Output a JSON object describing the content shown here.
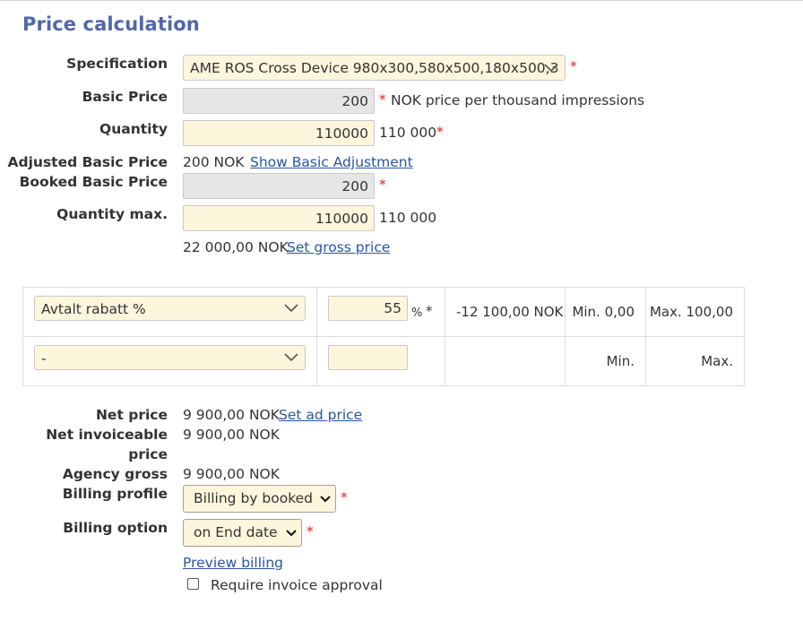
{
  "page": {
    "title": "Price calculation"
  },
  "fields": {
    "specification": {
      "label": "Specification",
      "value": "AME ROS Cross Device 980x300,580x500,180x500,3",
      "required": "*"
    },
    "basic_price": {
      "label": "Basic Price",
      "value": "200",
      "required": "*",
      "unit_note": "NOK price per thousand impressions"
    },
    "quantity": {
      "label": "Quantity",
      "value": "110000",
      "formatted": "110 000",
      "required": "*"
    },
    "adjusted_basic_price": {
      "label": "Adjusted Basic Price",
      "value": "200 NOK",
      "link": "Show Basic Adjustment"
    },
    "booked_basic_price": {
      "label": "Booked Basic Price",
      "value": "200",
      "required": "*"
    },
    "quantity_max": {
      "label": "Quantity max.",
      "value": "110000",
      "formatted": "110 000"
    },
    "gross": {
      "value": "22 000,00 NOK",
      "link": "Set gross price"
    }
  },
  "discounts": [
    {
      "type": "Avtalt rabatt %",
      "value": "55",
      "unit": "%",
      "required": "*",
      "amount": "-12 100,00 NOK",
      "min": "Min. 0,00",
      "max": "Max. 100,00"
    },
    {
      "type": "-",
      "value": "",
      "unit": "",
      "required": "",
      "amount": "",
      "min": "Min.",
      "max": "Max."
    }
  ],
  "summary": {
    "net_price": {
      "label": "Net price",
      "value": "9 900,00 NOK",
      "link": "Set ad price"
    },
    "net_invoiceable_price": {
      "label_line1": "Net invoiceable",
      "label_line2": "price",
      "value": "9 900,00 NOK"
    },
    "agency_gross": {
      "label": "Agency gross",
      "value": "9 900,00 NOK"
    },
    "billing_profile": {
      "label": "Billing profile",
      "value": "Billing by booked",
      "required": "*"
    },
    "billing_option": {
      "label": "Billing option",
      "value": "on End date",
      "required": "*"
    },
    "preview_billing": "Preview billing",
    "require_invoice_approval": {
      "label": "Require invoice approval",
      "checked": false
    }
  },
  "colors": {
    "title": "#5068a8",
    "link": "#2a55a0",
    "required": "#e02020",
    "input_bg": "#fdf6dc",
    "readonly_bg": "#e6e6e6"
  }
}
